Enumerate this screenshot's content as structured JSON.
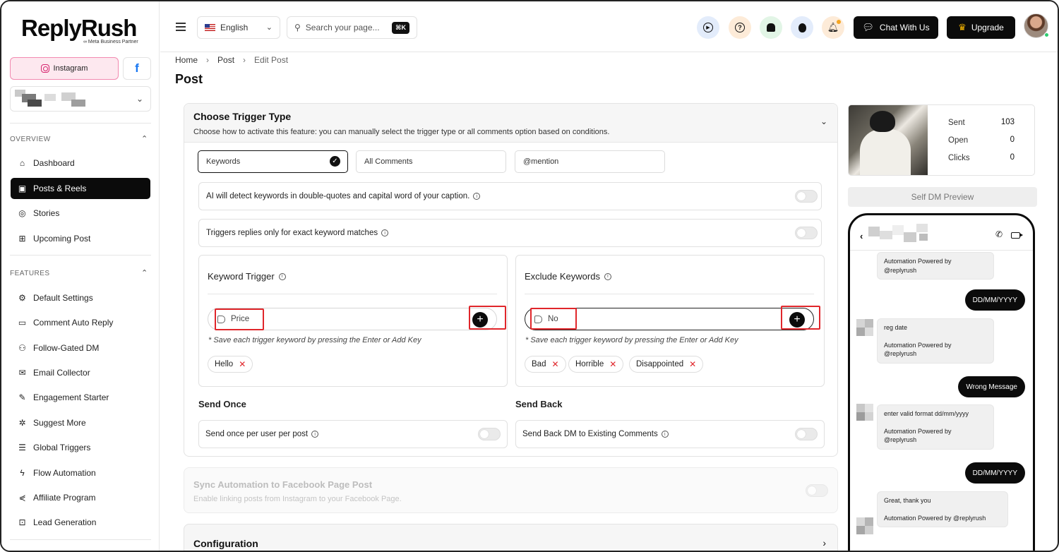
{
  "brand": {
    "name": "ReplyRush",
    "partner_badge": "∞ Meta Business Partner"
  },
  "sidebar": {
    "instagram_label": "Instagram",
    "facebook_label": "f",
    "overview_label": "OVERVIEW",
    "features_label": "FEATURES",
    "overview_items": [
      {
        "label": "Dashboard",
        "icon": "home-icon"
      },
      {
        "label": "Posts & Reels",
        "icon": "image-icon"
      },
      {
        "label": "Stories",
        "icon": "instagram-icon"
      },
      {
        "label": "Upcoming Post",
        "icon": "calendar-plus-icon"
      }
    ],
    "feature_items": [
      {
        "label": "Default Settings",
        "icon": "gear-icon"
      },
      {
        "label": "Comment Auto Reply",
        "icon": "comment-icon"
      },
      {
        "label": "Follow-Gated DM",
        "icon": "users-icon"
      },
      {
        "label": "Email Collector",
        "icon": "mail-icon"
      },
      {
        "label": "Engagement Starter",
        "icon": "chat-edit-icon"
      },
      {
        "label": "Suggest More",
        "icon": "gear-star-icon"
      },
      {
        "label": "Global Triggers",
        "icon": "list-icon"
      },
      {
        "label": "Flow Automation",
        "icon": "lightning-icon"
      },
      {
        "label": "Affiliate Program",
        "icon": "share-icon"
      },
      {
        "label": "Lead Generation",
        "icon": "lead-icon"
      }
    ]
  },
  "header": {
    "language": "English",
    "search_placeholder": "Search your page...",
    "search_shortcut": "⌘K",
    "chat_label": "Chat With Us",
    "upgrade_label": "Upgrade"
  },
  "breadcrumb": {
    "home": "Home",
    "post": "Post",
    "current": "Edit Post"
  },
  "page_title": "Post",
  "trigger": {
    "title": "Choose Trigger Type",
    "subtitle": "Choose how to activate this feature: you can manually select the trigger type or all comments option based on conditions.",
    "options": [
      "Keywords",
      "All Comments",
      "@mention"
    ],
    "ai_detect": "AI will detect keywords in double-quotes and capital word of your caption.",
    "exact_match": "Triggers replies only for exact keyword matches"
  },
  "keyword_trigger": {
    "title": "Keyword Trigger",
    "input_value": "Price",
    "hint": "* Save each trigger keyword by pressing the Enter or Add Key",
    "chips": [
      "Hello"
    ]
  },
  "exclude_keywords": {
    "title": "Exclude Keywords",
    "input_value": "No",
    "hint": "* Save each trigger keyword by pressing the Enter or Add Key",
    "chips": [
      "Bad",
      "Horrible",
      "Disappointed"
    ]
  },
  "send_once": {
    "title": "Send Once",
    "label": "Send once per user per post"
  },
  "send_back": {
    "title": "Send Back",
    "label": "Send Back DM to Existing Comments"
  },
  "sync": {
    "title": "Sync Automation to Facebook Page Post",
    "subtitle": "Enable linking posts from Instagram to your Facebook Page."
  },
  "configuration": {
    "title": "Configuration"
  },
  "stats": {
    "sent_label": "Sent",
    "sent_value": "103",
    "open_label": "Open",
    "open_value": "0",
    "clicks_label": "Clicks",
    "clicks_value": "0"
  },
  "preview": {
    "button": "Self DM Preview",
    "messages": {
      "m1_powered": "Automation Powered by",
      "m1_handle": "@replyrush",
      "out1": "DD/MM/YYYY",
      "m2_text": "reg date",
      "m2_powered": "Automation Powered by",
      "m2_handle": "@replyrush",
      "out2": "Wrong Message",
      "m3_text": "enter valid format dd/mm/yyyy",
      "m3_powered": "Automation Powered by",
      "m3_handle": "@replyrush",
      "out3": "DD/MM/YYYY",
      "m4_text": "Great, thank you",
      "m4_powered": "Automation Powered by @replyrush"
    }
  },
  "colors": {
    "accent": "#0b0b0b",
    "highlight": "#e0262b",
    "instagram": "#d6246e",
    "facebook": "#1877f2"
  }
}
